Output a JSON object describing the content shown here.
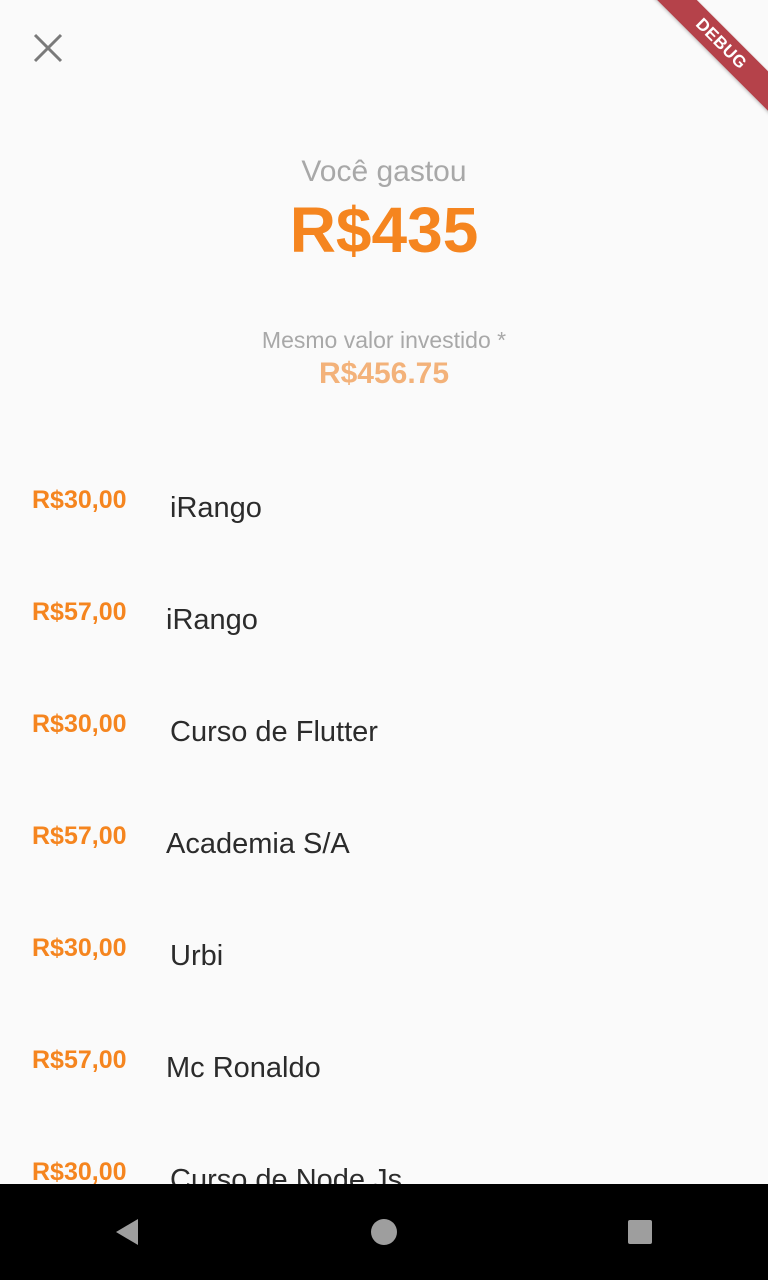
{
  "header": {
    "close_icon": "close-icon",
    "debug_banner": "DEBUG"
  },
  "summary": {
    "spent_label": "Você gastou",
    "spent_value": "R$435"
  },
  "investment": {
    "label": "Mesmo valor investido *",
    "value": "R$456.75"
  },
  "expenses": [
    {
      "price": "R$30,00",
      "name": "iRango"
    },
    {
      "price": "R$57,00",
      "name": "iRango"
    },
    {
      "price": "R$30,00",
      "name": "Curso de Flutter"
    },
    {
      "price": "R$57,00",
      "name": "Academia S/A"
    },
    {
      "price": "R$30,00",
      "name": "Urbi"
    },
    {
      "price": "R$57,00",
      "name": "Mc Ronaldo"
    },
    {
      "price": "R$30,00",
      "name": "Curso de Node Js"
    }
  ],
  "navbar": {
    "back_icon": "back-triangle-icon",
    "home_icon": "home-circle-icon",
    "recents_icon": "recents-square-icon"
  },
  "colors": {
    "accent": "#f5851f",
    "accent_light": "#f3b27a",
    "muted_text": "#a8a8a8",
    "debug_ribbon": "#b5424a"
  }
}
